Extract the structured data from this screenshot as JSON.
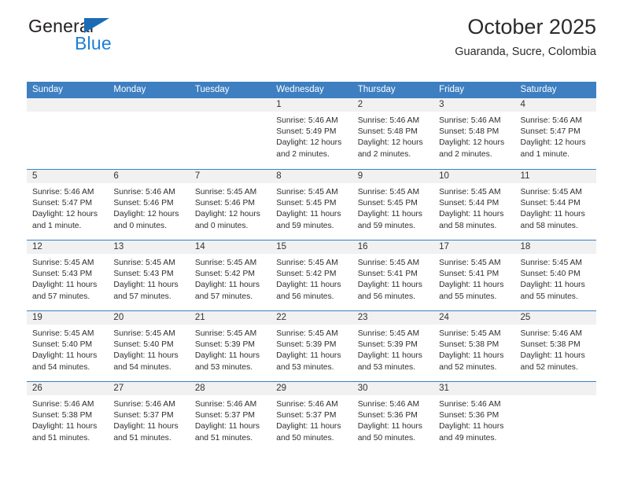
{
  "brand": {
    "word1": "General",
    "word2": "Blue",
    "triangle_color": "#1b6cb5",
    "blue_text_color": "#1b7fd4"
  },
  "header": {
    "title": "October 2025",
    "subtitle": "Guaranda, Sucre, Colombia"
  },
  "theme": {
    "header_row_bg": "#3d7fc1",
    "daynum_bg": "#f1f1f1",
    "text": "#2e2e2e"
  },
  "calendar": {
    "weekday_headers": [
      "Sunday",
      "Monday",
      "Tuesday",
      "Wednesday",
      "Thursday",
      "Friday",
      "Saturday"
    ],
    "labels": {
      "sunrise": "Sunrise:",
      "sunset": "Sunset:",
      "daylight": "Daylight:"
    },
    "weeks": [
      [
        {
          "day": ""
        },
        {
          "day": ""
        },
        {
          "day": ""
        },
        {
          "day": "1",
          "sunrise": "Sunrise: 5:46 AM",
          "sunset": "Sunset: 5:49 PM",
          "daylight1": "Daylight: 12 hours",
          "daylight2": "and 2 minutes."
        },
        {
          "day": "2",
          "sunrise": "Sunrise: 5:46 AM",
          "sunset": "Sunset: 5:48 PM",
          "daylight1": "Daylight: 12 hours",
          "daylight2": "and 2 minutes."
        },
        {
          "day": "3",
          "sunrise": "Sunrise: 5:46 AM",
          "sunset": "Sunset: 5:48 PM",
          "daylight1": "Daylight: 12 hours",
          "daylight2": "and 2 minutes."
        },
        {
          "day": "4",
          "sunrise": "Sunrise: 5:46 AM",
          "sunset": "Sunset: 5:47 PM",
          "daylight1": "Daylight: 12 hours",
          "daylight2": "and 1 minute."
        }
      ],
      [
        {
          "day": "5",
          "sunrise": "Sunrise: 5:46 AM",
          "sunset": "Sunset: 5:47 PM",
          "daylight1": "Daylight: 12 hours",
          "daylight2": "and 1 minute."
        },
        {
          "day": "6",
          "sunrise": "Sunrise: 5:46 AM",
          "sunset": "Sunset: 5:46 PM",
          "daylight1": "Daylight: 12 hours",
          "daylight2": "and 0 minutes."
        },
        {
          "day": "7",
          "sunrise": "Sunrise: 5:45 AM",
          "sunset": "Sunset: 5:46 PM",
          "daylight1": "Daylight: 12 hours",
          "daylight2": "and 0 minutes."
        },
        {
          "day": "8",
          "sunrise": "Sunrise: 5:45 AM",
          "sunset": "Sunset: 5:45 PM",
          "daylight1": "Daylight: 11 hours",
          "daylight2": "and 59 minutes."
        },
        {
          "day": "9",
          "sunrise": "Sunrise: 5:45 AM",
          "sunset": "Sunset: 5:45 PM",
          "daylight1": "Daylight: 11 hours",
          "daylight2": "and 59 minutes."
        },
        {
          "day": "10",
          "sunrise": "Sunrise: 5:45 AM",
          "sunset": "Sunset: 5:44 PM",
          "daylight1": "Daylight: 11 hours",
          "daylight2": "and 58 minutes."
        },
        {
          "day": "11",
          "sunrise": "Sunrise: 5:45 AM",
          "sunset": "Sunset: 5:44 PM",
          "daylight1": "Daylight: 11 hours",
          "daylight2": "and 58 minutes."
        }
      ],
      [
        {
          "day": "12",
          "sunrise": "Sunrise: 5:45 AM",
          "sunset": "Sunset: 5:43 PM",
          "daylight1": "Daylight: 11 hours",
          "daylight2": "and 57 minutes."
        },
        {
          "day": "13",
          "sunrise": "Sunrise: 5:45 AM",
          "sunset": "Sunset: 5:43 PM",
          "daylight1": "Daylight: 11 hours",
          "daylight2": "and 57 minutes."
        },
        {
          "day": "14",
          "sunrise": "Sunrise: 5:45 AM",
          "sunset": "Sunset: 5:42 PM",
          "daylight1": "Daylight: 11 hours",
          "daylight2": "and 57 minutes."
        },
        {
          "day": "15",
          "sunrise": "Sunrise: 5:45 AM",
          "sunset": "Sunset: 5:42 PM",
          "daylight1": "Daylight: 11 hours",
          "daylight2": "and 56 minutes."
        },
        {
          "day": "16",
          "sunrise": "Sunrise: 5:45 AM",
          "sunset": "Sunset: 5:41 PM",
          "daylight1": "Daylight: 11 hours",
          "daylight2": "and 56 minutes."
        },
        {
          "day": "17",
          "sunrise": "Sunrise: 5:45 AM",
          "sunset": "Sunset: 5:41 PM",
          "daylight1": "Daylight: 11 hours",
          "daylight2": "and 55 minutes."
        },
        {
          "day": "18",
          "sunrise": "Sunrise: 5:45 AM",
          "sunset": "Sunset: 5:40 PM",
          "daylight1": "Daylight: 11 hours",
          "daylight2": "and 55 minutes."
        }
      ],
      [
        {
          "day": "19",
          "sunrise": "Sunrise: 5:45 AM",
          "sunset": "Sunset: 5:40 PM",
          "daylight1": "Daylight: 11 hours",
          "daylight2": "and 54 minutes."
        },
        {
          "day": "20",
          "sunrise": "Sunrise: 5:45 AM",
          "sunset": "Sunset: 5:40 PM",
          "daylight1": "Daylight: 11 hours",
          "daylight2": "and 54 minutes."
        },
        {
          "day": "21",
          "sunrise": "Sunrise: 5:45 AM",
          "sunset": "Sunset: 5:39 PM",
          "daylight1": "Daylight: 11 hours",
          "daylight2": "and 53 minutes."
        },
        {
          "day": "22",
          "sunrise": "Sunrise: 5:45 AM",
          "sunset": "Sunset: 5:39 PM",
          "daylight1": "Daylight: 11 hours",
          "daylight2": "and 53 minutes."
        },
        {
          "day": "23",
          "sunrise": "Sunrise: 5:45 AM",
          "sunset": "Sunset: 5:39 PM",
          "daylight1": "Daylight: 11 hours",
          "daylight2": "and 53 minutes."
        },
        {
          "day": "24",
          "sunrise": "Sunrise: 5:45 AM",
          "sunset": "Sunset: 5:38 PM",
          "daylight1": "Daylight: 11 hours",
          "daylight2": "and 52 minutes."
        },
        {
          "day": "25",
          "sunrise": "Sunrise: 5:46 AM",
          "sunset": "Sunset: 5:38 PM",
          "daylight1": "Daylight: 11 hours",
          "daylight2": "and 52 minutes."
        }
      ],
      [
        {
          "day": "26",
          "sunrise": "Sunrise: 5:46 AM",
          "sunset": "Sunset: 5:38 PM",
          "daylight1": "Daylight: 11 hours",
          "daylight2": "and 51 minutes."
        },
        {
          "day": "27",
          "sunrise": "Sunrise: 5:46 AM",
          "sunset": "Sunset: 5:37 PM",
          "daylight1": "Daylight: 11 hours",
          "daylight2": "and 51 minutes."
        },
        {
          "day": "28",
          "sunrise": "Sunrise: 5:46 AM",
          "sunset": "Sunset: 5:37 PM",
          "daylight1": "Daylight: 11 hours",
          "daylight2": "and 51 minutes."
        },
        {
          "day": "29",
          "sunrise": "Sunrise: 5:46 AM",
          "sunset": "Sunset: 5:37 PM",
          "daylight1": "Daylight: 11 hours",
          "daylight2": "and 50 minutes."
        },
        {
          "day": "30",
          "sunrise": "Sunrise: 5:46 AM",
          "sunset": "Sunset: 5:36 PM",
          "daylight1": "Daylight: 11 hours",
          "daylight2": "and 50 minutes."
        },
        {
          "day": "31",
          "sunrise": "Sunrise: 5:46 AM",
          "sunset": "Sunset: 5:36 PM",
          "daylight1": "Daylight: 11 hours",
          "daylight2": "and 49 minutes."
        },
        {
          "day": ""
        }
      ]
    ]
  }
}
